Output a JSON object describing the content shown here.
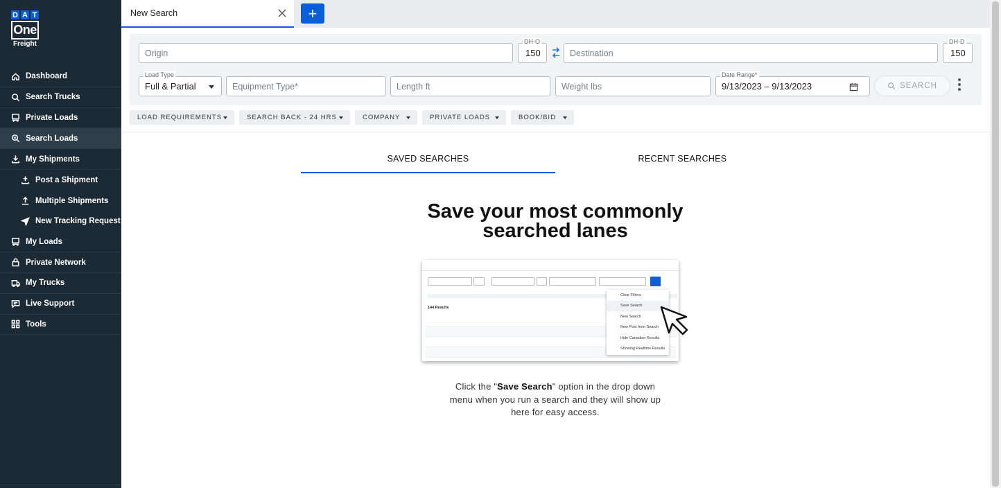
{
  "logo": {
    "letters": [
      "D",
      "A",
      "T"
    ],
    "one": "One",
    "freight": "Freight"
  },
  "sidebar": {
    "items": [
      {
        "label": "Dashboard",
        "icon": "home-icon"
      },
      {
        "label": "Search Trucks",
        "icon": "search-icon"
      },
      {
        "label": "Private Loads",
        "icon": "truck-icon"
      },
      {
        "label": "Search Loads",
        "icon": "search-loads-icon",
        "active": true
      },
      {
        "label": "My Shipments",
        "icon": "download-icon"
      },
      {
        "label": "Post a Shipment",
        "icon": "post-icon",
        "sub": true
      },
      {
        "label": "Multiple Shipments",
        "icon": "upload-icon",
        "sub": true
      },
      {
        "label": "New Tracking Request",
        "icon": "navigation-icon",
        "sub": true
      },
      {
        "label": "My Loads",
        "icon": "truck-icon"
      },
      {
        "label": "Private Network",
        "icon": "lock-icon"
      },
      {
        "label": "My Trucks",
        "icon": "truck-outline-icon"
      },
      {
        "label": "Live Support",
        "icon": "chat-icon"
      },
      {
        "label": "Tools",
        "icon": "grid-icon"
      }
    ]
  },
  "tabs": {
    "active_label": "New Search",
    "add_label": "+"
  },
  "search": {
    "origin_placeholder": "Origin",
    "dho_label": "DH-O",
    "dho_value": "150",
    "destination_placeholder": "Destination",
    "dhd_label": "DH-D",
    "dhd_value": "150",
    "load_type_label": "Load Type",
    "load_type_value": "Full & Partial",
    "equipment_placeholder": "Equipment Type*",
    "length_placeholder": "Length ft",
    "weight_placeholder": "Weight lbs",
    "date_range_label": "Date Range*",
    "date_range_value": "9/13/2023 – 9/13/2023",
    "search_button": "SEARCH"
  },
  "filters": [
    "LOAD REQUIREMENTS",
    "SEARCH BACK - 24 HRS",
    "COMPANY",
    "PRIVATE LOADS",
    "BOOK/BID"
  ],
  "saved_tabs": {
    "saved": "SAVED SEARCHES",
    "recent": "RECENT SEARCHES"
  },
  "empty_state": {
    "headline": "Save your most commonly searched lanes",
    "help_prefix": "Click the \"",
    "help_bold": "Save Search",
    "help_suffix": "\" option in the drop down menu when you run a search and they will show up here for easy access."
  },
  "illustration_menu": [
    "Clear Filters",
    "Save Search",
    "New Search",
    "New Post from Search",
    "Hide Canadian Results",
    "Showing Realtime Results"
  ],
  "colors": {
    "sidebar": "#1c2a35",
    "accent": "#0a5fd6"
  }
}
